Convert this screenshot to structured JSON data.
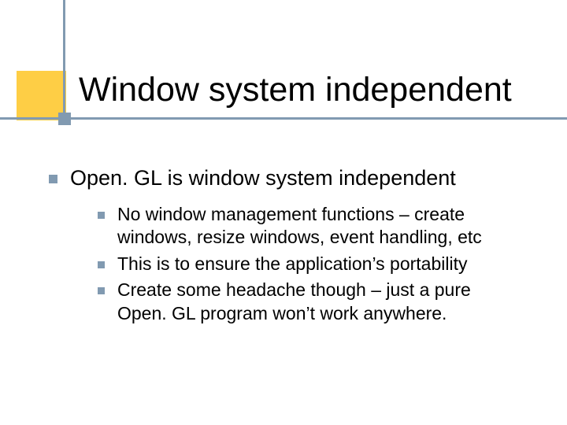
{
  "slide": {
    "title": "Window system independent",
    "points": [
      {
        "text": "Open. GL is window system independent",
        "children": [
          "No window management functions – create windows, resize windows, event handling, etc",
          "This is to ensure the application’s portability",
          "Create some headache though – just a pure Open. GL program won’t work anywhere."
        ]
      }
    ]
  }
}
